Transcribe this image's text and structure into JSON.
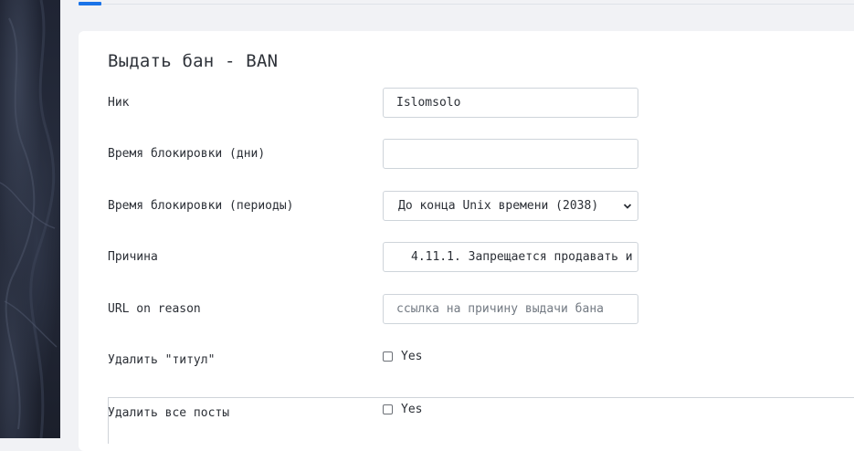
{
  "form": {
    "title": "Выдать бан - BAN",
    "fields": {
      "nick": {
        "label": "Ник",
        "value": "Islomsolo"
      },
      "ban_days": {
        "label": "Время блокировки (дни)",
        "value": ""
      },
      "ban_period": {
        "label": "Время блокировки (периоды)",
        "selected": "До конца Unix времени (2038)"
      },
      "reason": {
        "label": "Причина",
        "value": "4.11.1. Запрещается продавать и"
      },
      "url_reason": {
        "label": "URL on reason",
        "placeholder": "ссылка на причину выдачи бана"
      },
      "remove_title": {
        "label": "Удалить \"титул\"",
        "option": "Yes",
        "checked": false
      },
      "remove_posts": {
        "label": "Удалить все посты",
        "option": "Yes",
        "checked": false
      }
    }
  },
  "colors": {
    "accent": "#1a73e8",
    "background": "#f1f2f5",
    "card": "#ffffff",
    "sidebar": "#1f2433"
  },
  "icons": {
    "select_arrow": "chevron-down-icon"
  }
}
